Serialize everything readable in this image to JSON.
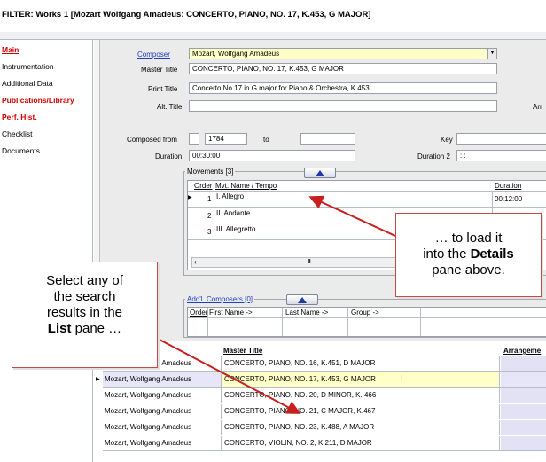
{
  "title": "FILTER: Works  1 [Mozart Wolfgang Amadeus: CONCERTO, PIANO, NO. 17, K.453, G MAJOR]",
  "nav": [
    {
      "label": "Main",
      "style": "red-underline"
    },
    {
      "label": "Instrumentation",
      "style": "normal"
    },
    {
      "label": "Additional Data",
      "style": "normal"
    },
    {
      "label": "Publications/Library",
      "style": "red"
    },
    {
      "label": "Perf. Hist.",
      "style": "red"
    },
    {
      "label": "Checklist",
      "style": "normal"
    },
    {
      "label": "Documents",
      "style": "normal"
    }
  ],
  "form": {
    "composer_label": "Composer",
    "composer_value": "Mozart, Wolfgang Amadeus",
    "master_title_label": "Master Title",
    "master_title_value": "CONCERTO, PIANO, NO. 17, K.453, G MAJOR",
    "print_title_label": "Print Title",
    "print_title_value": "Concerto No.17 in G major for Piano & Orchestra, K.453",
    "alt_title_label": "Alt. Title",
    "alt_title_value": "",
    "arr_label": "Arr",
    "composed_from_label": "Composed from",
    "composed_from_value": "1784",
    "to_label": "to",
    "to_value": "",
    "key_label": "Key",
    "key_value": "",
    "duration_label": "Duration",
    "duration_value": "00:30:00",
    "duration2_label": "Duration 2",
    "duration2_value": " :  :"
  },
  "movements": {
    "title": "Movements  [3]",
    "col_order": "Order",
    "col_name": "Mvt. Name / Tempo",
    "col_duration": "Duration",
    "rows": [
      {
        "order": "1",
        "name": "I. Allegro",
        "duration": "00:12:00"
      },
      {
        "order": "2",
        "name": "II. Andante",
        "duration": ""
      },
      {
        "order": "3",
        "name": "III. Allegretto",
        "duration": ""
      }
    ],
    "scroll_glyph": "III"
  },
  "addl_composers": {
    "title": "Add'l. Composers  [0]",
    "col_order": "Order",
    "col_first": "First Name ->",
    "col_last": "Last Name ->",
    "col_group": "Group ->"
  },
  "list": {
    "col_master_title": "Master Title",
    "col_arrangement": "Arrangeme",
    "rows": [
      {
        "composer": "Mozart, Wolfgang Amadeus",
        "title": "CONCERTO, PIANO, NO. 16, K.451, D MAJOR",
        "selected": false
      },
      {
        "composer": "Mozart, Wolfgang Amadeus",
        "title": "CONCERTO, PIANO, NO. 17, K.453, G MAJOR",
        "selected": true
      },
      {
        "composer": "Mozart, Wolfgang Amadeus",
        "title": "CONCERTO, PIANO, NO. 20, D MINOR, K. 466",
        "selected": false
      },
      {
        "composer": "Mozart, Wolfgang Amadeus",
        "title": "CONCERTO, PIANO, NO. 21, C MAJOR, K.467",
        "selected": false
      },
      {
        "composer": "Mozart, Wolfgang Amadeus",
        "title": "CONCERTO, PIANO, NO. 23, K.488, A MAJOR",
        "selected": false
      },
      {
        "composer": "Mozart, Wolfgang Amadeus",
        "title": "CONCERTO, VIOLIN, NO. 2, K.211, D MAJOR",
        "selected": false
      }
    ]
  },
  "callouts": {
    "left_1": "Select any of",
    "left_2": "the search",
    "left_3": "results in the",
    "left_4_bold": "List",
    "left_4_rest": " pane …",
    "right_1": "… to load it",
    "right_2_pre": "into the ",
    "right_2_bold": "Details",
    "right_3": "pane above."
  },
  "colors": {
    "nav_red": "#d00000",
    "link_blue": "#1a3fbf",
    "arrow_red": "#c8201e",
    "selected_yellow": "#ffffc8"
  }
}
